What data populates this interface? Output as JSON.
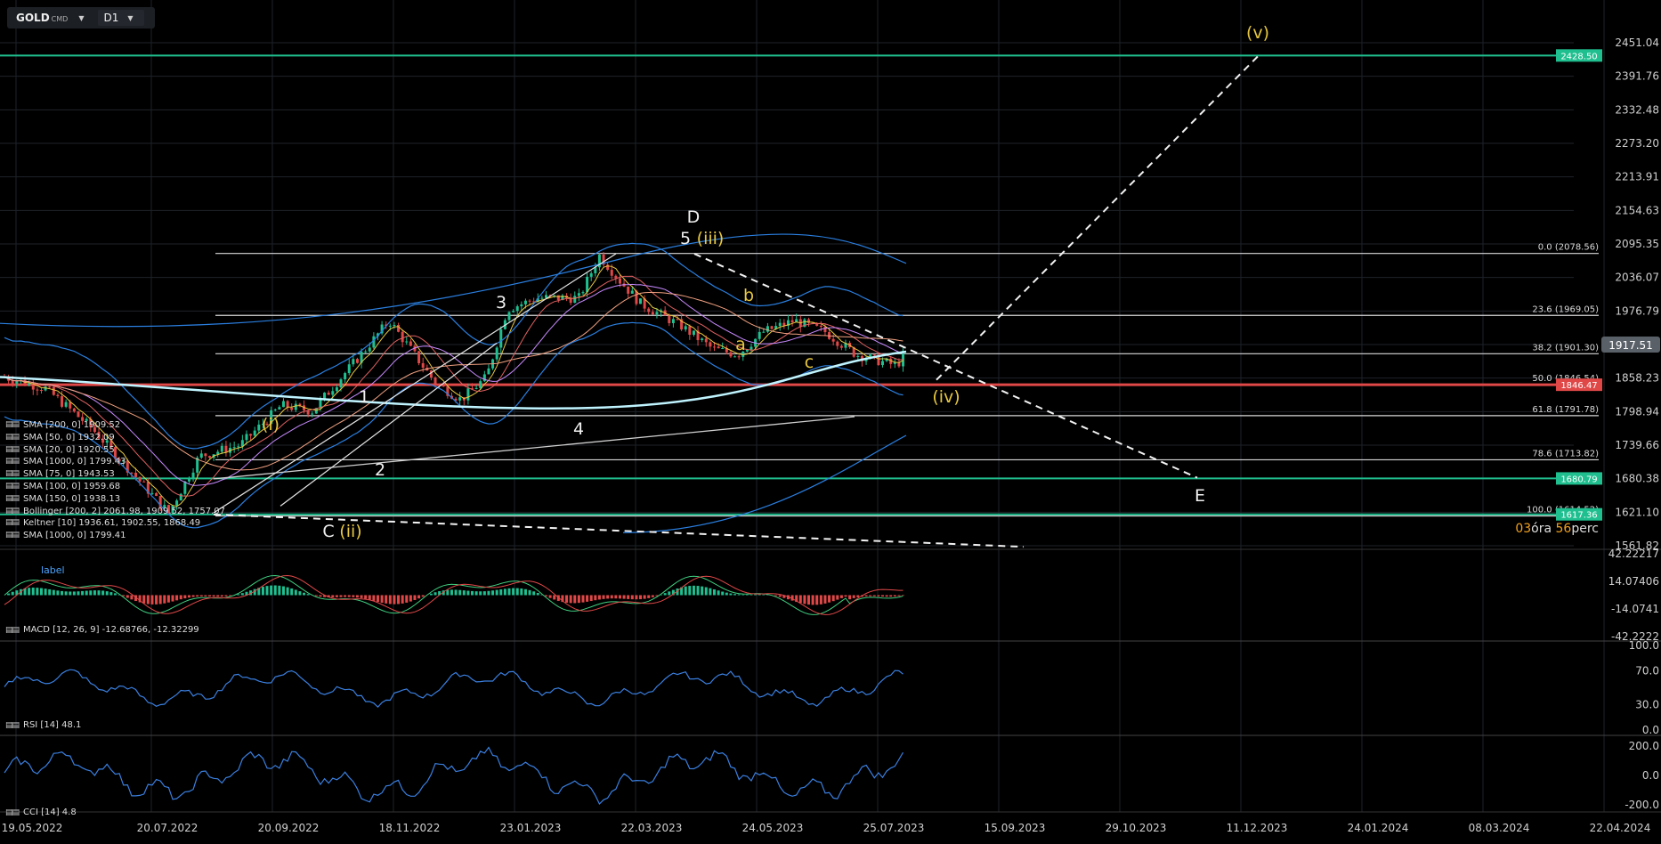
{
  "toolbar": {
    "symbol": "GOLD",
    "symbol_sub": "CMD",
    "timeframe": "D1"
  },
  "colors": {
    "background": "#000000",
    "grid": "#1e2228",
    "green_level": "#1fbf8f",
    "red_level": "#e04848",
    "price_badge": "#5a6068",
    "wave_yellow": "#e8c840",
    "bb_blue": "#2a7fe0",
    "macd_up": "#1fbf8f",
    "macd_down": "#e04848",
    "osc_blue": "#3a7fe0"
  },
  "chart_data": {
    "type": "candlestick",
    "symbol": "GOLD",
    "timeframe": "D1",
    "x_labels": [
      "19.05.2022",
      "20.07.2022",
      "20.09.2022",
      "18.11.2022",
      "23.01.2023",
      "22.03.2023",
      "24.05.2023",
      "25.07.2023",
      "15.09.2023",
      "29.10.2023",
      "11.12.2023",
      "24.01.2024",
      "08.03.2024",
      "22.04.2024"
    ],
    "y_labels": [
      "2451.04",
      "2391.76",
      "2332.48",
      "2273.20",
      "2213.91",
      "2154.63",
      "2095.35",
      "2036.07",
      "1976.79",
      "1917.51",
      "1858.23",
      "1798.94",
      "1739.66",
      "1680.38",
      "1621.10",
      "1561.82"
    ],
    "ylim": [
      1561.82,
      2451.04
    ],
    "last_price": "1917.51",
    "fib_levels": [
      {
        "label": "0.0 (2078.56)",
        "value": 2078.56
      },
      {
        "label": "23.6 (1969.05)",
        "value": 1969.05
      },
      {
        "label": "38.2 (1901.30)",
        "value": 1901.3
      },
      {
        "label": "50.0 (1846.54)",
        "value": 1846.54
      },
      {
        "label": "61.8 (1791.78)",
        "value": 1791.78
      },
      {
        "label": "78.6 (1713.82)",
        "value": 1713.82
      },
      {
        "label": "100.0 (1614.52)",
        "value": 1614.52
      }
    ],
    "horizontal_levels": [
      {
        "label": "2428.50",
        "value": 2428.5,
        "color": "green"
      },
      {
        "label": "1846.47",
        "value": 1846.47,
        "color": "red"
      },
      {
        "label": "1680.79",
        "value": 1680.79,
        "color": "green"
      },
      {
        "label": "1617.36",
        "value": 1617.36,
        "color": "green"
      }
    ],
    "wave_labels": [
      "(v)",
      "D",
      "5",
      "(iii)",
      "3",
      "b",
      "a",
      "c",
      "1",
      "(iv)",
      "4",
      "(i)",
      "2",
      "C",
      "(ii)",
      "E"
    ],
    "indicators": [
      "SMA [200, 0] 1909.52",
      "SMA [50, 0] 1932.09",
      "SMA [20, 0] 1920.55",
      "SMA [1000, 0] 1799.43",
      "SMA [75, 0] 1943.53",
      "SMA [100, 0] 1959.68",
      "SMA [150, 0] 1938.13",
      "Bollinger [200, 2] 2061.98, 1909.52, 1757.07",
      "Keltner [10] 1936.61, 1902.55, 1868.49",
      "SMA [1000, 0] 1799.41"
    ],
    "macd": {
      "label": "MACD [12, 26, 9] -12.68766, -12.32299",
      "note": "label",
      "y_labels": [
        "42.22217",
        "14.07406",
        "-14.0741",
        "-42.2222"
      ]
    },
    "rsi": {
      "label": "RSI [14] 48.1",
      "y_labels": [
        "100.0",
        "70.0",
        "30.0",
        "0.0"
      ]
    },
    "cci": {
      "label": "CCI [14] 4.8",
      "y_labels": [
        "200.0",
        "0.0",
        "-200.0"
      ]
    },
    "timer": {
      "hours": "03",
      "hours_word": "óra",
      "minutes": "56",
      "minutes_word": "perc"
    }
  }
}
